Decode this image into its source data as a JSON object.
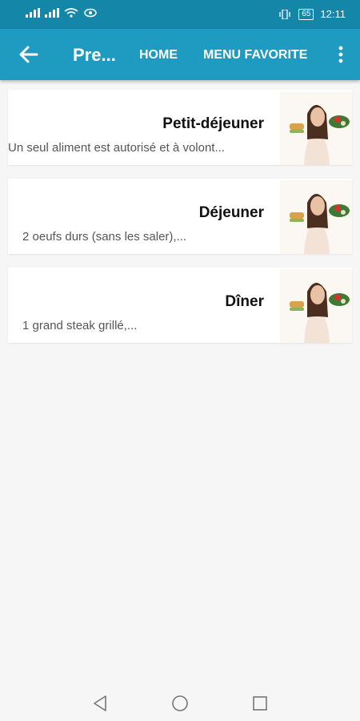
{
  "status_bar": {
    "battery": "65",
    "time": "12:11",
    "left_icons": [
      "signal-icon",
      "signal-icon",
      "wifi-icon",
      "eye-icon"
    ],
    "right_icons": [
      "vibrate-icon",
      "battery-icon"
    ]
  },
  "app_bar": {
    "title": "Pre...",
    "actions": {
      "home": "HOME",
      "favorites": "MENU FAVORITE"
    },
    "icons": {
      "back": "back-arrow-icon",
      "overflow": "overflow-menu-icon"
    },
    "background_color": "#1f9ac0",
    "status_color": "#1486a8"
  },
  "meals": [
    {
      "title": "Petit-déjeuner",
      "description": "Un seul aliment est autorisé et à volont..."
    },
    {
      "title": "Déjeuner",
      "description": "2 oeufs durs (sans les saler),..."
    },
    {
      "title": "Dîner",
      "description": "1 grand steak grillé,..."
    }
  ],
  "nav_bar": {
    "icons": [
      "back-triangle-icon",
      "home-circle-icon",
      "recents-square-icon"
    ]
  }
}
